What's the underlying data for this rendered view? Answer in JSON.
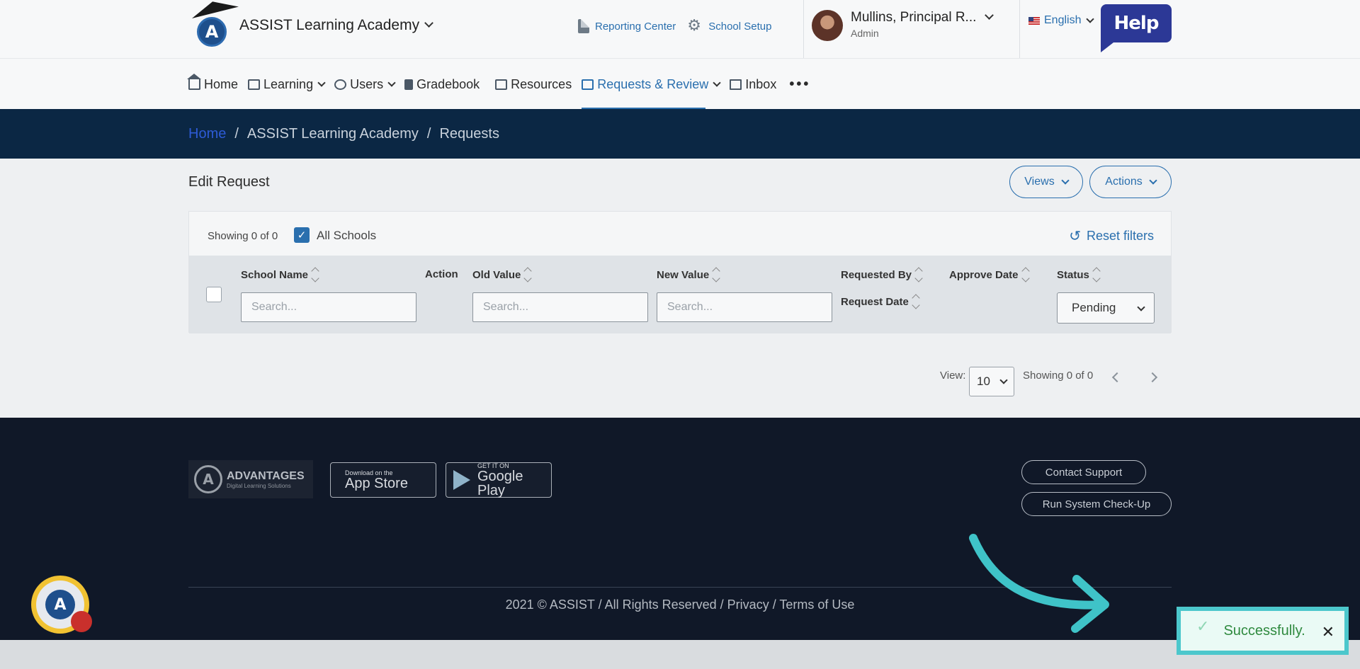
{
  "header": {
    "school_name": "ASSIST Learning Academy",
    "reporting_center": "Reporting Center",
    "school_setup": "School Setup",
    "user_name": "Mullins, Principal R...",
    "user_role": "Admin",
    "language": "English",
    "help": "Help"
  },
  "nav": {
    "items": [
      {
        "label": "Home",
        "icon": "home-icon"
      },
      {
        "label": "Learning",
        "icon": "learning-icon"
      },
      {
        "label": "Users",
        "icon": "users-icon"
      },
      {
        "label": "Gradebook",
        "icon": "gradebook-icon"
      },
      {
        "label": "Resources",
        "icon": "resources-icon"
      },
      {
        "label": "Requests & Review",
        "icon": "requests-icon"
      },
      {
        "label": "Inbox",
        "icon": "mail-icon"
      }
    ],
    "more": "•••"
  },
  "breadcrumb": {
    "home": "Home",
    "school": "ASSIST Learning Academy",
    "current": "Requests",
    "separator": "/"
  },
  "main": {
    "title": "Edit Request",
    "views_label": "Views",
    "actions_label": "Actions",
    "showing": "Showing 0 of 0",
    "all_schools": "All Schools",
    "reset_filters": "Reset filters",
    "columns": {
      "school_name": "School Name",
      "action": "Action",
      "old_value": "Old Value",
      "new_value": "New Value",
      "requested_by": "Requested By",
      "request_date": "Request Date",
      "approve_date": "Approve Date",
      "status": "Status"
    },
    "search_placeholder": "Search...",
    "status_value": "Pending",
    "pager": {
      "view_label": "View:",
      "page_size": "10",
      "showing": "Showing 0 of 0"
    }
  },
  "footer": {
    "advantages_title": "ADVANTAGES",
    "advantages_sub": "Digital Learning Solutions",
    "app_store_small": "Download on the",
    "app_store_big": "App Store",
    "google_small": "GET IT ON",
    "google_big": "Google Play",
    "contact_support": "Contact Support",
    "system_check": "Run System Check-Up",
    "copyright": "2021 © ASSIST / All Rights Reserved / Privacy / Terms of Use"
  },
  "toast": {
    "message": "Successfully.",
    "close": "✕"
  },
  "colors": {
    "accent": "#2a6fae",
    "header_dark": "#0b2744",
    "footer_dark": "#101828",
    "toast_border": "#4cc7cc",
    "success_text": "#2f8a3f"
  }
}
